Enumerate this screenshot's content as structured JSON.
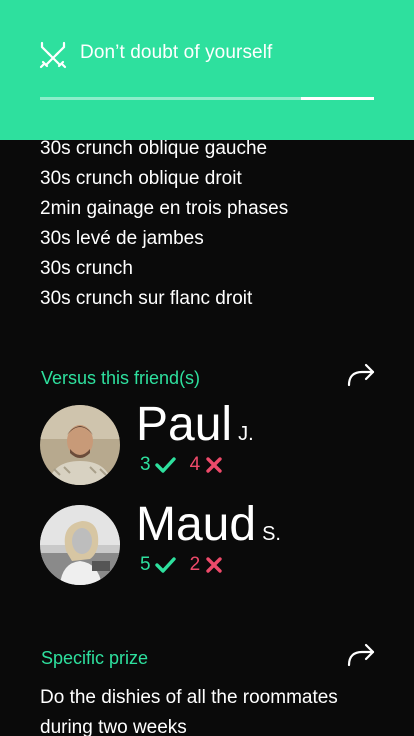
{
  "header": {
    "title": "Don’t doubt of yourself",
    "icon": "crossed-swords-icon",
    "progress": 0.78,
    "background": "#2ee09e"
  },
  "exercises": [
    "30s crunch oblique gauche",
    "30s crunch oblique droit",
    "2min gainage en trois phases",
    "30s levé de jambes",
    "30s crunch",
    "30s crunch sur flanc droit"
  ],
  "versus": {
    "title": "Versus this friend(s)",
    "friends": [
      {
        "name": "Paul",
        "initial": "J.",
        "wins": "3",
        "losses": "4"
      },
      {
        "name": "Maud",
        "initial": "S.",
        "wins": "5",
        "losses": "2"
      }
    ]
  },
  "prize": {
    "title": "Specific prize",
    "text": "Do the dishies of all the roommates during two weeks"
  },
  "colors": {
    "accent": "#2ee09e",
    "loss": "#ee4a6a",
    "background": "#0a0a0a"
  }
}
